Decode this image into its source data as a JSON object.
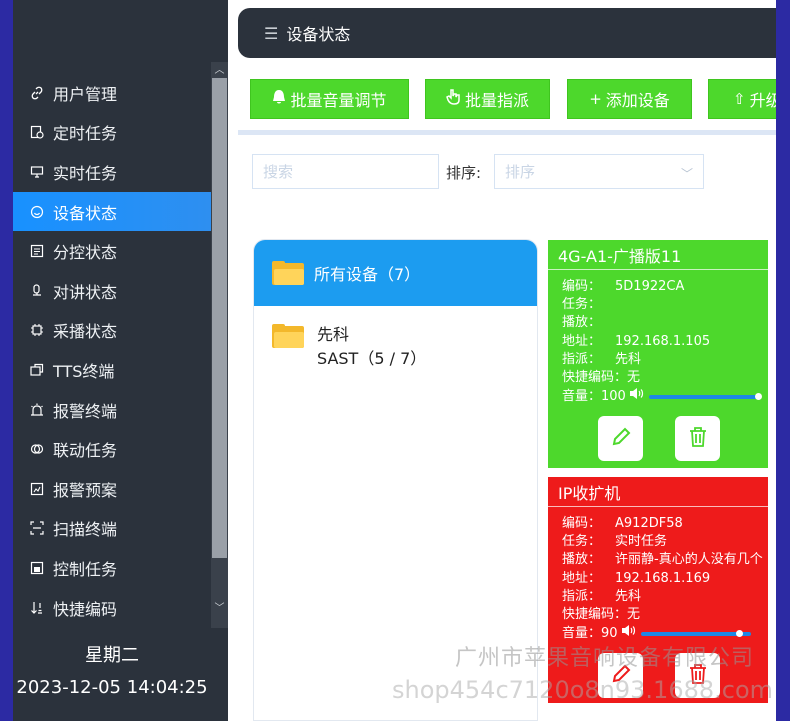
{
  "sidebar": {
    "items": [
      {
        "label": "用户管理",
        "icon": "link-icon"
      },
      {
        "label": "定时任务",
        "icon": "clock-doc-icon"
      },
      {
        "label": "实时任务",
        "icon": "monitor-icon"
      },
      {
        "label": "设备状态",
        "icon": "smiley-icon",
        "active": true
      },
      {
        "label": "分控状态",
        "icon": "list-doc-icon"
      },
      {
        "label": "对讲状态",
        "icon": "microphone-icon"
      },
      {
        "label": "采播状态",
        "icon": "chip-icon"
      },
      {
        "label": "TTS终端",
        "icon": "terminal-icon"
      },
      {
        "label": "报警终端",
        "icon": "alarm-icon"
      },
      {
        "label": "联动任务",
        "icon": "link-circle-icon"
      },
      {
        "label": "报警预案",
        "icon": "chart-doc-icon"
      },
      {
        "label": "扫描终端",
        "icon": "scan-icon"
      },
      {
        "label": "控制任务",
        "icon": "control-doc-icon"
      },
      {
        "label": "快捷编码",
        "icon": "sort-icon"
      }
    ],
    "weekday": "星期二",
    "datetime": "2023-12-05 14:04:25"
  },
  "header": {
    "title": "设备状态"
  },
  "toolbar": {
    "buttons": [
      {
        "label": "批量音量调节",
        "icon": "bell-icon"
      },
      {
        "label": "批量指派",
        "icon": "hand-icon"
      },
      {
        "label": "添加设备",
        "icon": "plus-icon"
      },
      {
        "label": "升级",
        "icon": "upload-icon"
      }
    ]
  },
  "filters": {
    "search_placeholder": "搜索",
    "sort_label": "排序:",
    "sort_placeholder": "排序"
  },
  "tree": {
    "root_label": "所有设备（7）",
    "node_name": "先科",
    "node_detail": "SAST（5 / 7）"
  },
  "devices": [
    {
      "name": "4G-A1-广播版11",
      "status_color": "#4dd82c",
      "fields": [
        {
          "key": "编码：",
          "value": "5D1922CA"
        },
        {
          "key": "任务：",
          "value": ""
        },
        {
          "key": "播放：",
          "value": ""
        },
        {
          "key": "地址：",
          "value": "192.168.1.105"
        },
        {
          "key": "指派：",
          "value": "先科"
        },
        {
          "key": "快捷编码：",
          "value": "无"
        }
      ],
      "volume_label": "音量：",
      "volume": 100
    },
    {
      "name": "IP收扩机",
      "status_color": "#ee1b1b",
      "fields": [
        {
          "key": "编码：",
          "value": "A912DF58"
        },
        {
          "key": "任务：",
          "value": "实时任务"
        },
        {
          "key": "播放：",
          "value": "许丽静-真心的人没有几个"
        },
        {
          "key": "地址：",
          "value": "192.168.1.169"
        },
        {
          "key": "指派：",
          "value": "先科"
        },
        {
          "key": "快捷编码：",
          "value": "无"
        }
      ],
      "volume_label": "音量：",
      "volume": 90
    }
  ],
  "watermark": {
    "line1": "广州市苹果音响设备有限公司",
    "line2": "shop454c7120o8n93.1688.com"
  }
}
